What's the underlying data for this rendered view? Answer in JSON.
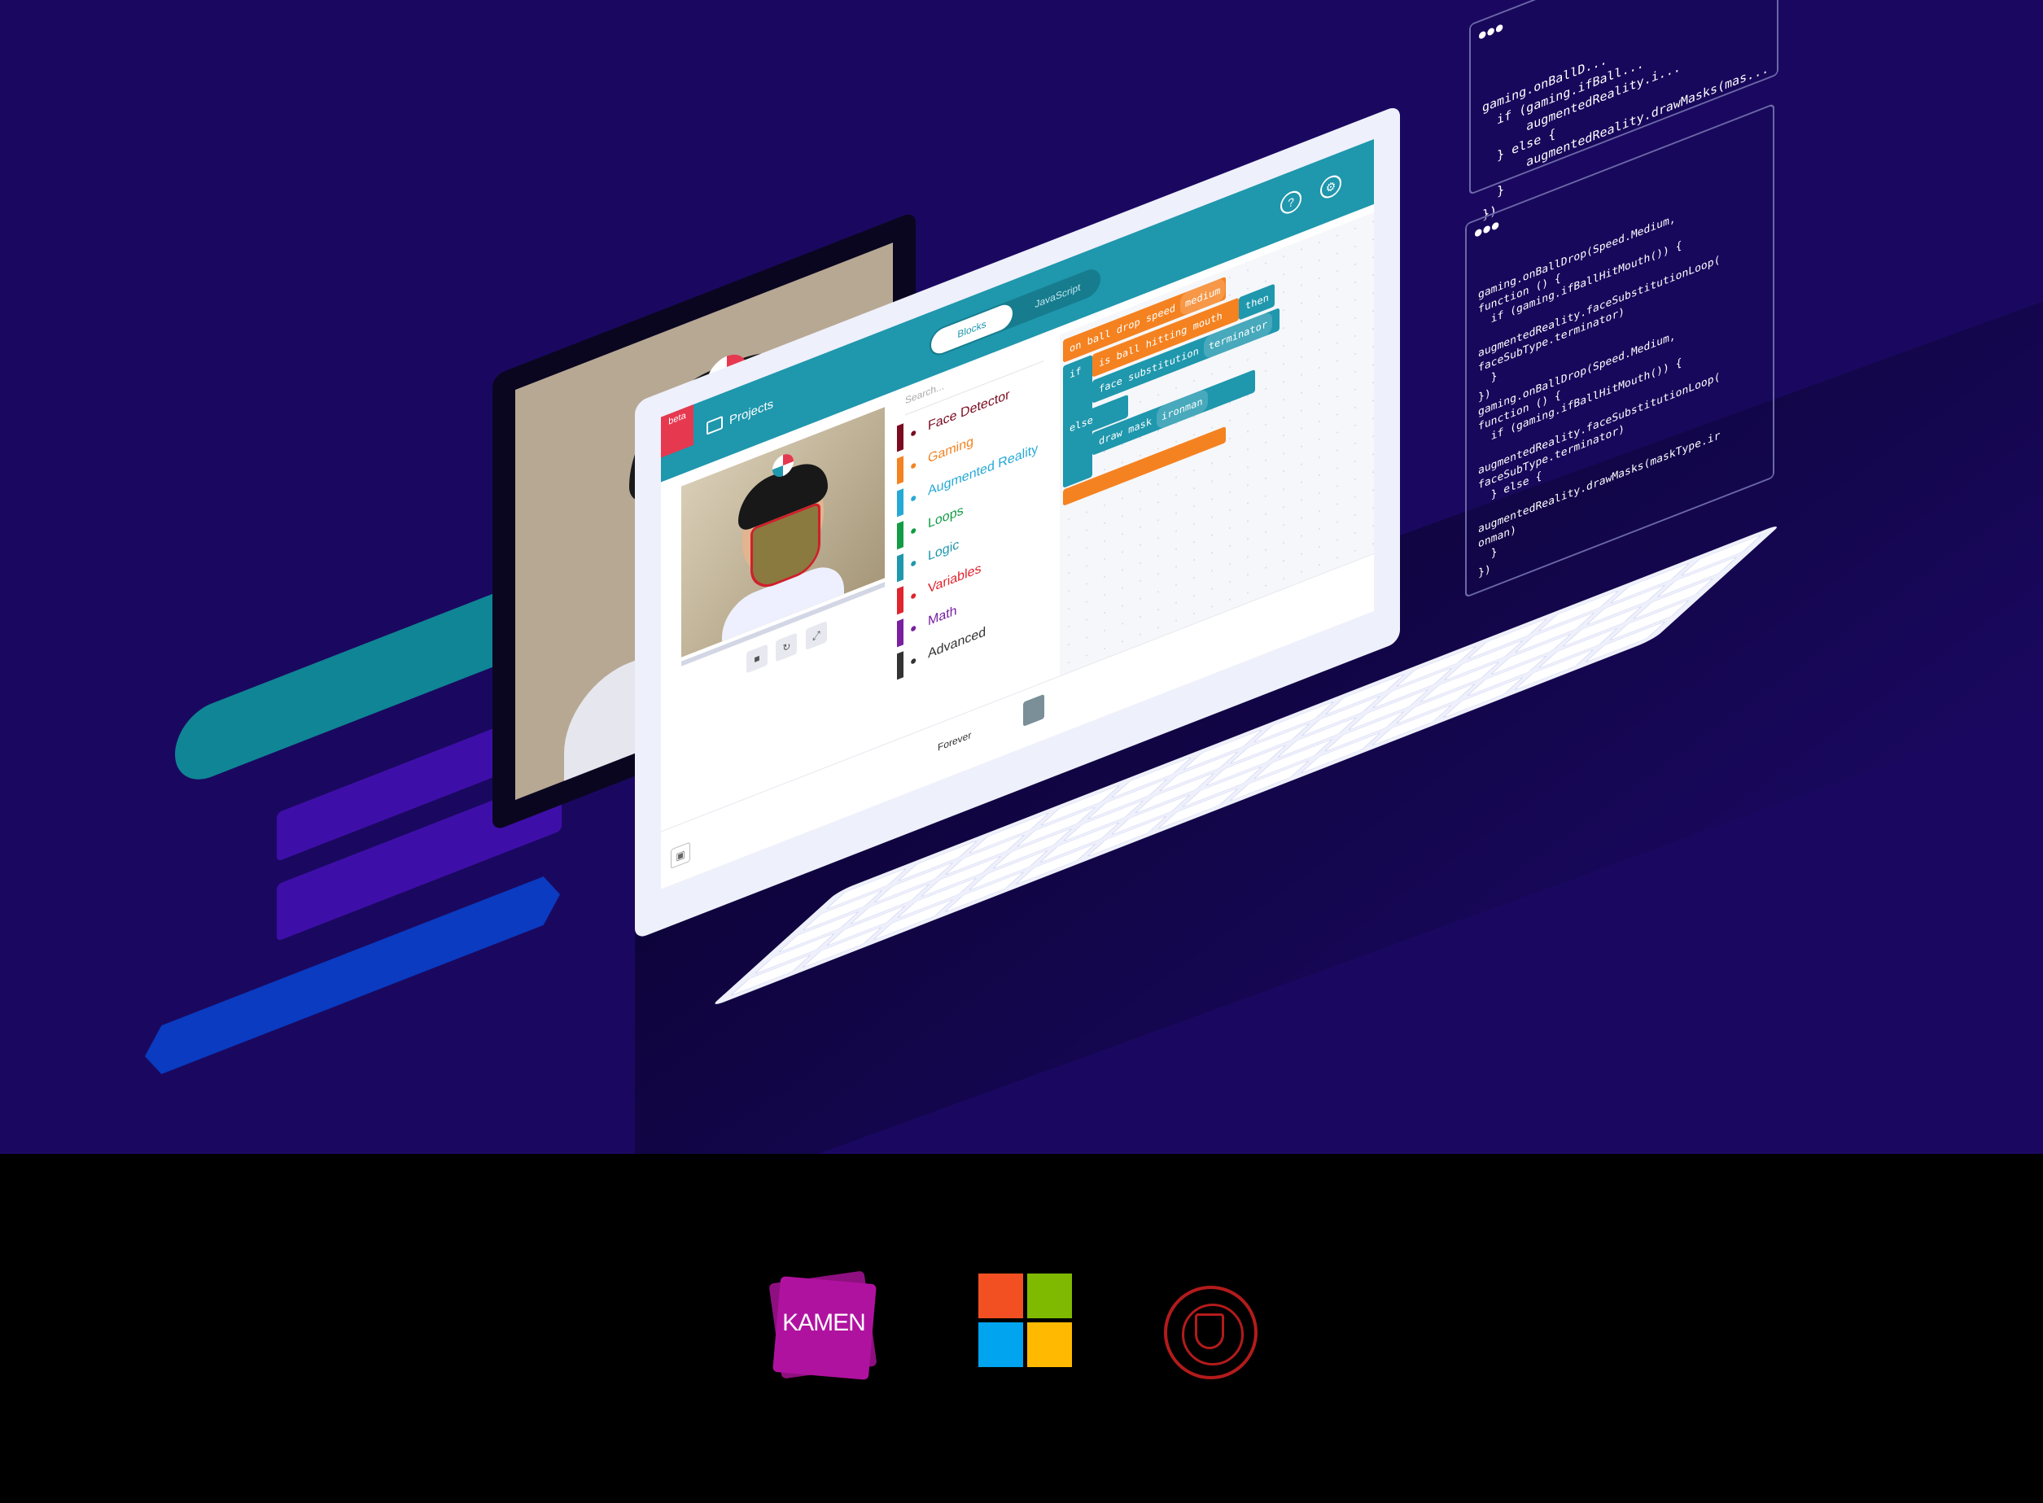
{
  "app": {
    "beta_badge": "beta",
    "projects_label": "Projects",
    "mode_blocks": "Blocks",
    "mode_javascript": "JavaScript",
    "help_icon": "help-icon",
    "settings_icon": "gear-icon",
    "search_placeholder": "Search..."
  },
  "toolbox": {
    "categories": [
      {
        "label": "Face Detector",
        "color": "#7a0c1f",
        "icon": "face-icon"
      },
      {
        "label": "Gaming",
        "color": "#f58220",
        "icon": "gamepad-icon"
      },
      {
        "label": "Augmented Reality",
        "color": "#27a9d6",
        "icon": "smile-icon"
      },
      {
        "label": "Loops",
        "color": "#129c45",
        "icon": "loop-icon"
      },
      {
        "label": "Logic",
        "color": "#1f97ad",
        "icon": "shuffle-icon"
      },
      {
        "label": "Variables",
        "color": "#e0252f",
        "icon": "list-icon"
      },
      {
        "label": "Math",
        "color": "#7a1fa0",
        "icon": "grid-icon"
      },
      {
        "label": "Advanced",
        "color": "#333333",
        "icon": "chevron-icon"
      }
    ]
  },
  "blocks": {
    "event": "on ball drop speed",
    "event_dd": "medium",
    "if_kw": "if",
    "cond": "is ball hitting mouth",
    "then_kw": "then",
    "face_sub": "face substitution",
    "face_sub_dd": "terminator",
    "else_kw": "else",
    "draw_mask": "draw mask",
    "draw_mask_dd": "ironman"
  },
  "footer_row": {
    "forever_label": "Forever"
  },
  "code_panel_1": {
    "code": "gaming.onBallD...\n  if (gaming.ifBall...\n      augmentedReality.i...\n  } else {\n      augmentedReality.drawMasks(mas...\n  }\n})"
  },
  "code_panel_2": {
    "code": "gaming.onBallDrop(Speed.Medium,\nfunction () {\n  if (gaming.ifBallHitMouth()) {\n\naugmentedReality.faceSubstitutionLoop(\nfaceSubType.terminator)\n  }\n})\ngaming.onBallDrop(Speed.Medium,\nfunction () {\n  if (gaming.ifBallHitMouth()) {\n\naugmentedReality.faceSubstitutionLoop(\nfaceSubType.terminator)\n  } else {\n\naugmentedReality.drawMasks(maskType.ir\nonman)\n  }\n})"
  },
  "logos": {
    "kamen_text": "KAMEN",
    "microsoft_colors": [
      "#f25022",
      "#7fba00",
      "#00a4ef",
      "#ffb900"
    ],
    "cornell_color": "#b31b1b"
  }
}
